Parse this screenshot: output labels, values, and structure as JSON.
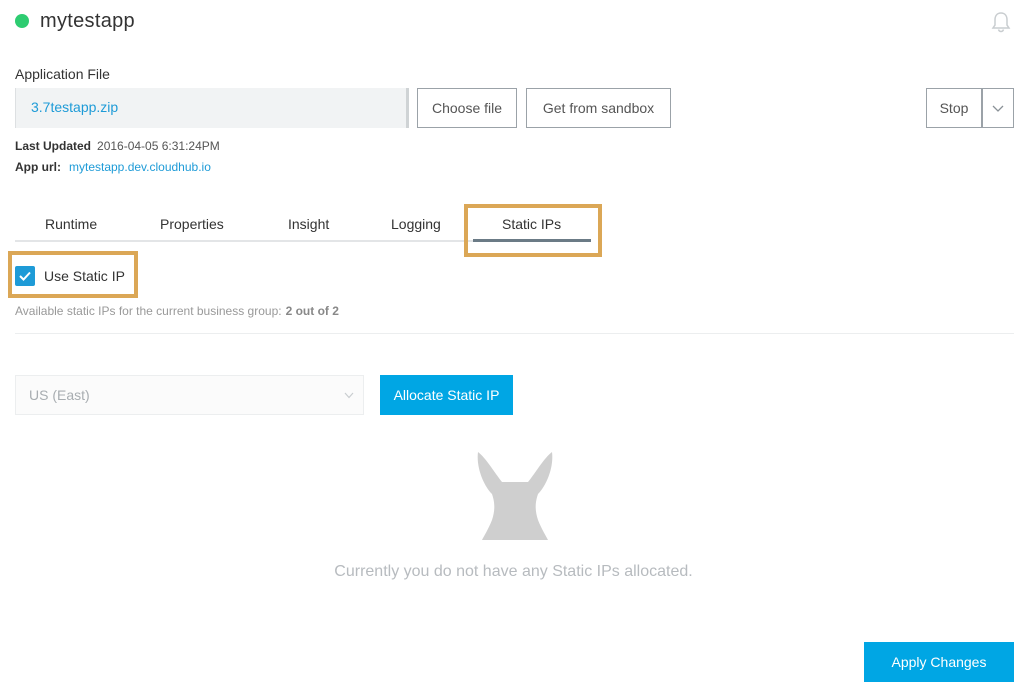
{
  "app": {
    "name": "mytestapp",
    "status_color": "#2ecc71"
  },
  "application_file": {
    "label": "Application File",
    "value": "3.7testapp.zip",
    "choose_label": "Choose file",
    "sandbox_label": "Get from sandbox",
    "stop_label": "Stop"
  },
  "meta": {
    "last_updated_label": "Last Updated",
    "last_updated_value": "2016-04-05 6:31:24PM",
    "app_url_label": "App url:",
    "app_url_value": "mytestapp.dev.cloudhub.io"
  },
  "tabs": [
    {
      "label": "Runtime"
    },
    {
      "label": "Properties"
    },
    {
      "label": "Insight"
    },
    {
      "label": "Logging"
    },
    {
      "label": "Static IPs",
      "active": true
    }
  ],
  "static_ip": {
    "checkbox_label": "Use Static IP",
    "checked": true,
    "available_text": "Available static IPs for the current business group:",
    "available_count": "2 out of 2",
    "region_value": "US (East)",
    "allocate_label": "Allocate Static IP",
    "empty_message": "Currently you do not have any Static IPs allocated."
  },
  "footer": {
    "apply_label": "Apply Changes"
  },
  "colors": {
    "accent": "#00a6e4",
    "link": "#1e9bd7",
    "highlight": "#dba756"
  },
  "icons": [
    "bell-icon",
    "chevron-down-icon",
    "checkmark-icon",
    "empty-state-mascot-icon"
  ]
}
